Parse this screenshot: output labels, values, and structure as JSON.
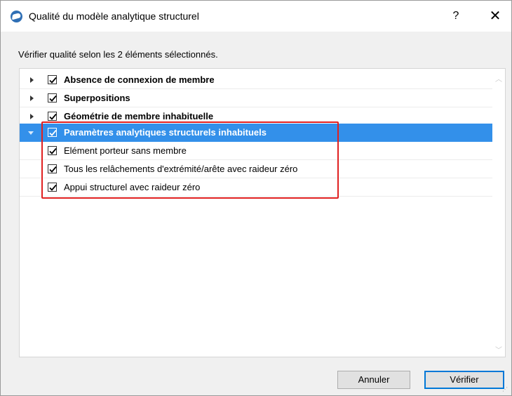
{
  "window": {
    "title": "Qualité du modèle analytique structurel",
    "help_label": "?",
    "close_label": "✕"
  },
  "info_text": "Vérifier qualité selon les 2 éléments sélectionnés.",
  "tree": {
    "items": [
      {
        "label": "Absence de connexion de membre",
        "checked": true,
        "expanded": false,
        "level": 0
      },
      {
        "label": "Superpositions",
        "checked": true,
        "expanded": false,
        "level": 0
      },
      {
        "label": "Géométrie de membre inhabituelle",
        "checked": true,
        "expanded": false,
        "level": 0
      },
      {
        "label": "Paramètres analytiques structurels inhabituels",
        "checked": true,
        "expanded": true,
        "selected": true,
        "level": 0
      },
      {
        "label": "Elément porteur sans membre",
        "checked": true,
        "level": 1
      },
      {
        "label": "Tous les relâchements d'extrémité/arête avec raideur zéro",
        "checked": true,
        "level": 1
      },
      {
        "label": "Appui structurel avec raideur zéro",
        "checked": true,
        "level": 1
      }
    ]
  },
  "buttons": {
    "cancel": "Annuler",
    "verify": "Vérifier"
  },
  "colors": {
    "selection": "#3390ea",
    "highlight": "#e02020",
    "default_button_border": "#0078d7"
  }
}
